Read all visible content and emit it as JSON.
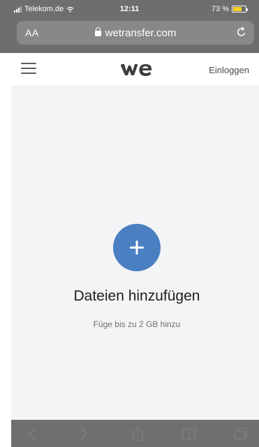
{
  "status_bar": {
    "carrier": "Telekom.de",
    "time": "12:11",
    "battery": "73 %",
    "battery_level": 0.73,
    "battery_color": "#ffd21f"
  },
  "browser": {
    "text_size_label": "AA",
    "url": "wetransfer.com",
    "icons": [
      "lock-icon",
      "reload-icon"
    ]
  },
  "header": {
    "menu_icon": "hamburger-menu-icon",
    "logo": "we",
    "login_label": "Einloggen"
  },
  "main": {
    "add_icon": "plus-icon",
    "title": "Dateien hinzufügen",
    "subtitle": "Füge bis zu 2 GB hinzu",
    "accent_color": "#4a7fc2",
    "background_color": "#f3f4f6"
  },
  "toolbar": {
    "items": [
      "back-icon",
      "forward-icon",
      "share-icon",
      "bookmarks-icon",
      "tabs-icon"
    ]
  }
}
